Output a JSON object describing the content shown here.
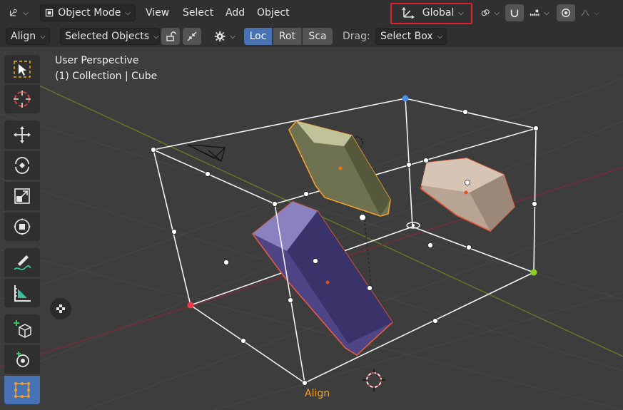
{
  "header": {
    "editor_type_icon": "transform-axes-icon",
    "mode_label": "Object Mode",
    "menus": [
      "View",
      "Select",
      "Add",
      "Object"
    ],
    "orientation_label": "Global",
    "pivot_icon": "link-icon",
    "snap_icon": "magnet-icon",
    "snap_target_icon": "snap-increment-icon",
    "proportional_icon": "proportional-edit-icon",
    "falloff_icon": "falloff-curve-icon"
  },
  "tool_settings": {
    "align_label": "Align",
    "selected_objects_label": "Selected Objects",
    "loc_label": "Loc",
    "rot_label": "Rot",
    "sca_label": "Sca",
    "drag_label": "Drag:",
    "drag_value": "Select Box"
  },
  "viewport": {
    "view_name": "User Perspective",
    "collection_label": "(1) Collection | Cube",
    "gizmo_label": "Align"
  },
  "toolbar": [
    {
      "name": "select-box-tool",
      "icon": "select-box-icon"
    },
    {
      "name": "cursor-tool",
      "icon": "cursor-icon"
    },
    {
      "name": "move-tool",
      "icon": "move-icon"
    },
    {
      "name": "rotate-tool",
      "icon": "rotate-icon"
    },
    {
      "name": "scale-tool",
      "icon": "scale-icon"
    },
    {
      "name": "transform-tool",
      "icon": "transform-icon"
    },
    {
      "name": "annotate-tool",
      "icon": "annotate-icon"
    },
    {
      "name": "measure-tool",
      "icon": "measure-icon"
    },
    {
      "name": "add-cube-tool",
      "icon": "add-cube-icon"
    },
    {
      "name": "shear-tool",
      "icon": "shear-icon"
    },
    {
      "name": "cage-tool",
      "icon": "cage-icon",
      "active": true
    }
  ],
  "colors": {
    "header_bg": "#303030",
    "viewport_bg": "#3d3d3d",
    "active_blue": "#4772b3",
    "highlight_red": "#e0202a",
    "gizmo_orange": "#f0a030",
    "x_axis": "#8a2e38",
    "y_axis": "#6a8a2a"
  }
}
